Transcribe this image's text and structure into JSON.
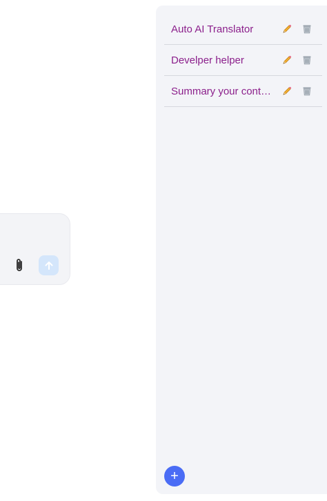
{
  "composer": {
    "attach_icon": "paperclip-icon",
    "send_icon": "arrow-up-icon"
  },
  "sidebar": {
    "prompts": [
      {
        "label": "Auto AI Translator"
      },
      {
        "label": "Develper helper"
      },
      {
        "label": "Summary your cont…"
      }
    ],
    "edit_icon": "pencil-icon",
    "delete_icon": "trash-icon",
    "add_label": "+"
  },
  "colors": {
    "prompt_text": "#8b1f8b",
    "accent": "#4a6cf5",
    "send_button_disabled": "#d4e6fb"
  }
}
